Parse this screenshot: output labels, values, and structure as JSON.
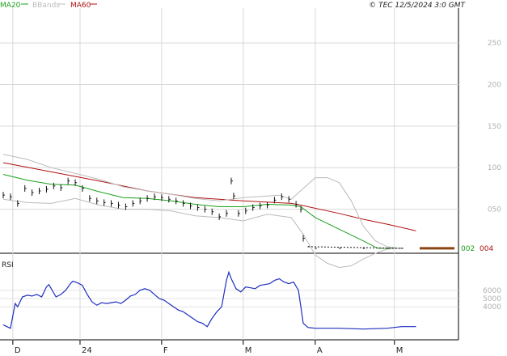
{
  "header": {
    "legend": [
      {
        "label": "MA20",
        "color": "#1aa01a"
      },
      {
        "label": "BBands",
        "color": "#bbbbbb"
      },
      {
        "label": "MA60",
        "color": "#b01010"
      }
    ],
    "copyright": "© TEC 12/5/2024 3:0 GMT"
  },
  "chart_data": [
    {
      "type": "line",
      "panel": "price",
      "ylim": [
        0,
        290
      ],
      "y_ticks": [
        {
          "value": 250,
          "label": "250"
        },
        {
          "value": 200,
          "label": "200"
        },
        {
          "value": 150,
          "label": "150"
        },
        {
          "value": 100,
          "label": "100"
        },
        {
          "value": 50,
          "label": "050"
        }
      ],
      "x_index_range": [
        0,
        188
      ],
      "x_ticks": [
        {
          "index": 4,
          "label": "D"
        },
        {
          "index": 32,
          "label": "24"
        },
        {
          "index": 66,
          "label": "F"
        },
        {
          "index": 100,
          "label": "M"
        },
        {
          "index": 130,
          "label": "A"
        },
        {
          "index": 163,
          "label": "M"
        }
      ],
      "last_value_labels": [
        {
          "label": "002",
          "value": 3,
          "color": "#1aa01a"
        },
        {
          "label": "004",
          "value": 3,
          "color": "#b01010"
        }
      ],
      "bar_points": [
        [
          0,
          67
        ],
        [
          3,
          65
        ],
        [
          6,
          57
        ],
        [
          9,
          75
        ],
        [
          12,
          70
        ],
        [
          15,
          72
        ],
        [
          18,
          74
        ],
        [
          21,
          78
        ],
        [
          24,
          76
        ],
        [
          27,
          84
        ],
        [
          30,
          82
        ],
        [
          33,
          75
        ],
        [
          36,
          63
        ],
        [
          39,
          60
        ],
        [
          42,
          58
        ],
        [
          45,
          57
        ],
        [
          48,
          55
        ],
        [
          51,
          53
        ],
        [
          54,
          57
        ],
        [
          57,
          60
        ],
        [
          60,
          63
        ],
        [
          63,
          65
        ],
        [
          66,
          64
        ],
        [
          69,
          62
        ],
        [
          72,
          60
        ],
        [
          75,
          57
        ],
        [
          78,
          54
        ],
        [
          81,
          52
        ],
        [
          84,
          50
        ],
        [
          87,
          47
        ],
        [
          90,
          41
        ],
        [
          93,
          45
        ],
        [
          95,
          84
        ],
        [
          96,
          66
        ],
        [
          98,
          45
        ],
        [
          101,
          48
        ],
        [
          104,
          52
        ],
        [
          107,
          54
        ],
        [
          110,
          55
        ],
        [
          113,
          61
        ],
        [
          116,
          65
        ],
        [
          119,
          62
        ],
        [
          122,
          56
        ],
        [
          124,
          50
        ],
        [
          125,
          15
        ],
        [
          127,
          5
        ],
        [
          130,
          3
        ],
        [
          140,
          3
        ],
        [
          150,
          3
        ],
        [
          160,
          3
        ],
        [
          166,
          3
        ]
      ],
      "series": [
        {
          "name": "MA20",
          "color": "#1aa01a",
          "points": [
            [
              0,
              92
            ],
            [
              10,
              85
            ],
            [
              20,
              80
            ],
            [
              30,
              79
            ],
            [
              40,
              71
            ],
            [
              50,
              64
            ],
            [
              60,
              63
            ],
            [
              70,
              60
            ],
            [
              80,
              56
            ],
            [
              90,
              53
            ],
            [
              100,
              53
            ],
            [
              110,
              56
            ],
            [
              120,
              55
            ],
            [
              124,
              53
            ],
            [
              130,
              40
            ],
            [
              140,
              26
            ],
            [
              150,
              12
            ],
            [
              156,
              3
            ],
            [
              166,
              3
            ]
          ]
        },
        {
          "name": "MA60",
          "color": "#b01010",
          "points": [
            [
              0,
              106
            ],
            [
              20,
              95
            ],
            [
              40,
              84
            ],
            [
              60,
              72
            ],
            [
              80,
              64
            ],
            [
              100,
              60
            ],
            [
              120,
              57
            ],
            [
              124,
              55
            ],
            [
              140,
              45
            ],
            [
              150,
              38
            ],
            [
              160,
              32
            ],
            [
              172,
              24
            ]
          ]
        },
        {
          "name": "BBands",
          "color": "#bbbbbb",
          "points": [
            [
              0,
              116
            ],
            [
              10,
              110
            ],
            [
              20,
              100
            ],
            [
              30,
              93
            ],
            [
              40,
              86
            ],
            [
              50,
              77
            ],
            [
              60,
              72
            ],
            [
              70,
              68
            ],
            [
              80,
              63
            ],
            [
              90,
              60
            ],
            [
              100,
              64
            ],
            [
              110,
              66
            ],
            [
              115,
              67
            ],
            [
              120,
              62
            ],
            [
              125,
              75
            ],
            [
              130,
              88
            ],
            [
              135,
              88
            ],
            [
              140,
              82
            ],
            [
              145,
              60
            ],
            [
              150,
              30
            ],
            [
              155,
              12
            ],
            [
              160,
              5
            ],
            [
              165,
              3
            ]
          ]
        },
        {
          "name": "BBands",
          "color": "#bbbbbb",
          "points": [
            [
              0,
              62
            ],
            [
              10,
              58
            ],
            [
              20,
              57
            ],
            [
              30,
              63
            ],
            [
              40,
              55
            ],
            [
              50,
              50
            ],
            [
              60,
              50
            ],
            [
              70,
              48
            ],
            [
              80,
              42
            ],
            [
              90,
              40
            ],
            [
              100,
              36
            ],
            [
              110,
              44
            ],
            [
              120,
              40
            ],
            [
              125,
              20
            ],
            [
              130,
              -5
            ],
            [
              135,
              -15
            ],
            [
              140,
              -20
            ],
            [
              145,
              -18
            ],
            [
              150,
              -10
            ],
            [
              155,
              -3
            ],
            [
              160,
              2
            ],
            [
              165,
              3
            ]
          ]
        }
      ]
    },
    {
      "type": "line",
      "panel": "rsi",
      "title": "RSI",
      "ylim": [
        0,
        100
      ],
      "y_ticks": [
        {
          "value": 60,
          "label": "6000"
        },
        {
          "value": 50,
          "label": "5000"
        },
        {
          "value": 40,
          "label": "4000"
        }
      ],
      "series": [
        {
          "name": "RSI",
          "color": "#1f2fbf",
          "points": [
            [
              0,
              18
            ],
            [
              3,
              14
            ],
            [
              5,
              44
            ],
            [
              6,
              40
            ],
            [
              8,
              52
            ],
            [
              10,
              54
            ],
            [
              12,
              53
            ],
            [
              14,
              55
            ],
            [
              16,
              52
            ],
            [
              18,
              64
            ],
            [
              19,
              67
            ],
            [
              20,
              62
            ],
            [
              22,
              52
            ],
            [
              24,
              55
            ],
            [
              26,
              60
            ],
            [
              28,
              68
            ],
            [
              29,
              71
            ],
            [
              31,
              69
            ],
            [
              33,
              66
            ],
            [
              35,
              55
            ],
            [
              37,
              46
            ],
            [
              39,
              42
            ],
            [
              41,
              45
            ],
            [
              43,
              44
            ],
            [
              45,
              45
            ],
            [
              47,
              46
            ],
            [
              49,
              44
            ],
            [
              51,
              48
            ],
            [
              53,
              53
            ],
            [
              55,
              55
            ],
            [
              57,
              60
            ],
            [
              59,
              62
            ],
            [
              61,
              60
            ],
            [
              63,
              55
            ],
            [
              65,
              50
            ],
            [
              67,
              48
            ],
            [
              69,
              44
            ],
            [
              71,
              40
            ],
            [
              73,
              36
            ],
            [
              75,
              34
            ],
            [
              77,
              30
            ],
            [
              79,
              26
            ],
            [
              81,
              22
            ],
            [
              83,
              20
            ],
            [
              85,
              16
            ],
            [
              87,
              26
            ],
            [
              89,
              34
            ],
            [
              91,
              40
            ],
            [
              93,
              72
            ],
            [
              94,
              82
            ],
            [
              95,
              74
            ],
            [
              97,
              62
            ],
            [
              99,
              58
            ],
            [
              101,
              64
            ],
            [
              103,
              63
            ],
            [
              105,
              62
            ],
            [
              107,
              66
            ],
            [
              109,
              67
            ],
            [
              111,
              68
            ],
            [
              113,
              72
            ],
            [
              115,
              74
            ],
            [
              117,
              70
            ],
            [
              119,
              68
            ],
            [
              121,
              70
            ],
            [
              123,
              60
            ],
            [
              125,
              20
            ],
            [
              127,
              15
            ],
            [
              130,
              14
            ],
            [
              140,
              14
            ],
            [
              150,
              13
            ],
            [
              160,
              14
            ],
            [
              166,
              16
            ],
            [
              172,
              16
            ]
          ]
        }
      ]
    }
  ]
}
